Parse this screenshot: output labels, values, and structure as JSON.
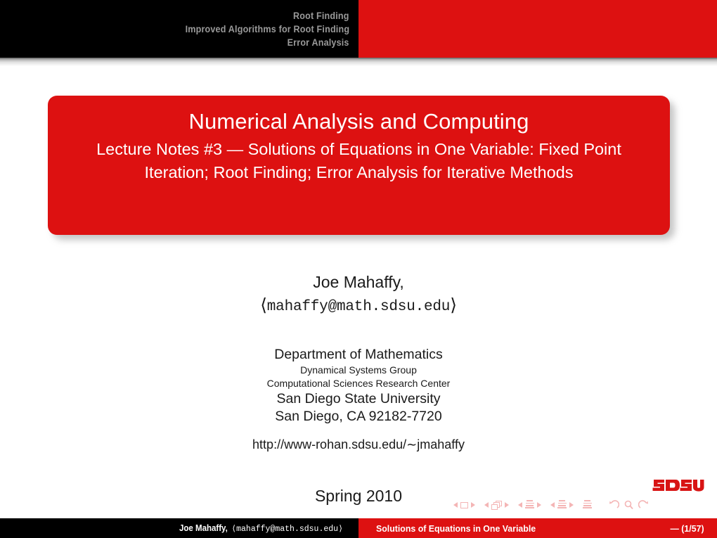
{
  "header": {
    "lines": [
      "Root Finding",
      "Improved Algorithms for Root Finding",
      "Error Analysis"
    ]
  },
  "title_box": {
    "title": "Numerical Analysis and Computing",
    "subtitle": "Lecture Notes #3 — Solutions of Equations in One Variable: Fixed Point Iteration; Root Finding; Error Analysis for Iterative Methods"
  },
  "author": {
    "name": "Joe Mahaffy,",
    "email_open": "⟨",
    "email": "mahaffy@math.sdsu.edu",
    "email_close": "⟩"
  },
  "institute": {
    "department": "Department of Mathematics",
    "group": "Dynamical Systems Group",
    "center": "Computational Sciences Research Center",
    "university": "San Diego State University",
    "city_zip": "San Diego, CA 92182-7720"
  },
  "url": "http://www-rohan.sdsu.edu/∼jmahaffy",
  "date": "Spring 2010",
  "logo": {
    "text": "SDSU"
  },
  "nav": {
    "first_slide": "first-slide",
    "prev_slide": "previous-slide",
    "next_slide": "next-slide",
    "last_slide": "last-slide",
    "back": "back",
    "search": "search",
    "forward": "forward"
  },
  "footer": {
    "author": "Joe Mahaffy,",
    "email_open": "⟨",
    "email": "mahaffy@math.sdsu.edu",
    "email_close": "⟩",
    "section": "Solutions of Equations in One Variable",
    "page": "— (1/57)"
  },
  "colors": {
    "accent_red": "#dd1111",
    "black_bar": "#000000",
    "header_text": "#9a9a9a",
    "nav_symbol": "#f4b5b5"
  }
}
